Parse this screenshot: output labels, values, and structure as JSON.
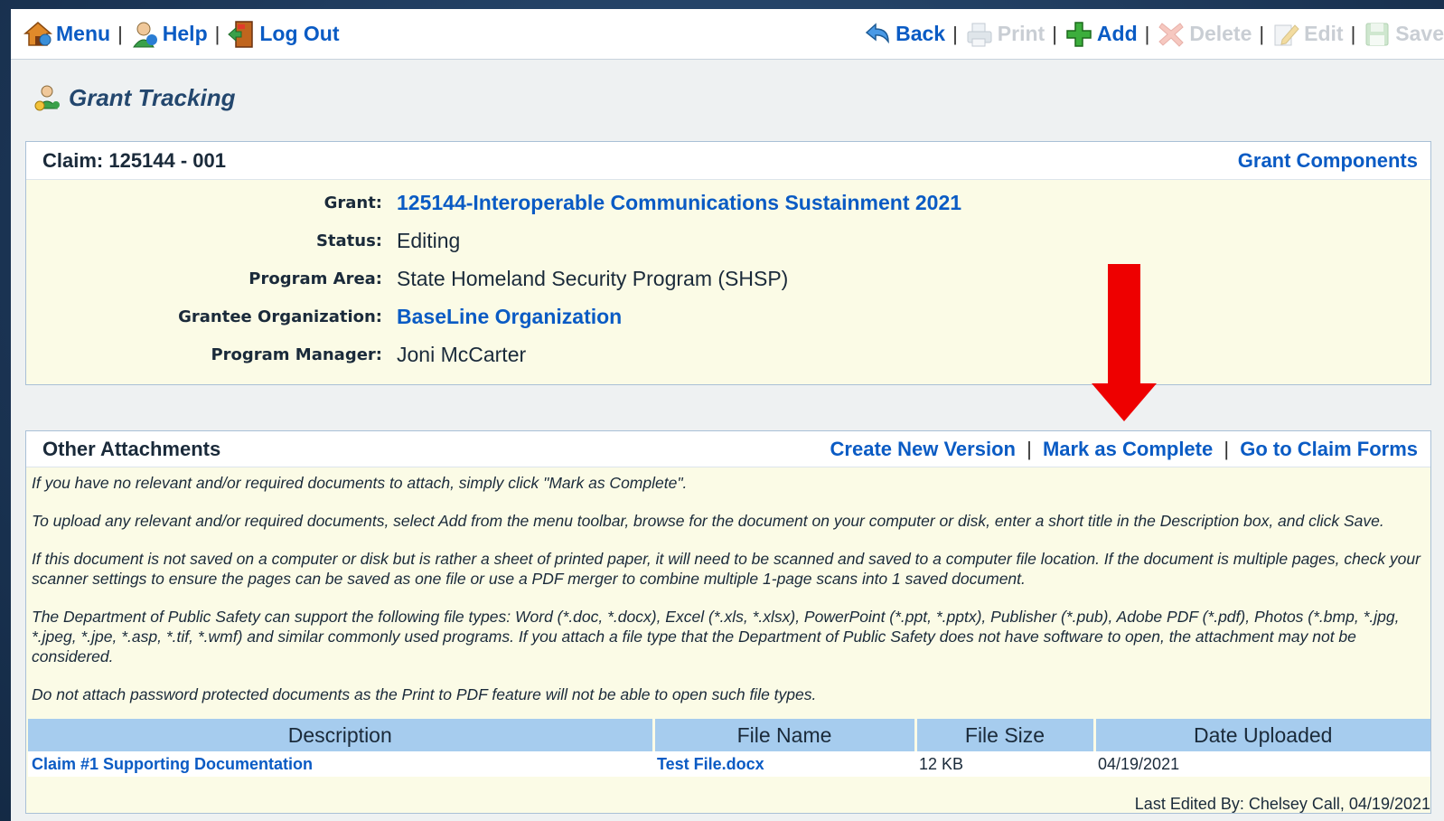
{
  "toolbar": {
    "left": [
      {
        "label": "Menu",
        "icon": "house-icon"
      },
      {
        "label": "Help",
        "icon": "help-person-icon"
      },
      {
        "label": "Log Out",
        "icon": "exit-door-icon"
      }
    ],
    "right": [
      {
        "label": "Back",
        "icon": "back-arrow-icon",
        "enabled": true
      },
      {
        "label": "Print",
        "icon": "printer-icon",
        "enabled": false
      },
      {
        "label": "Add",
        "icon": "add-plus-icon",
        "enabled": true
      },
      {
        "label": "Delete",
        "icon": "delete-x-icon",
        "enabled": false
      },
      {
        "label": "Edit",
        "icon": "edit-pencil-icon",
        "enabled": false
      },
      {
        "label": "Save",
        "icon": "save-disk-icon",
        "enabled": false
      }
    ],
    "separator": "|"
  },
  "page": {
    "title": "Grant Tracking"
  },
  "claim_panel": {
    "title": "Claim: 125144 - 001",
    "action": "Grant Components",
    "fields": {
      "grant_label": "Grant:",
      "grant_value": "125144-Interoperable Communications Sustainment 2021",
      "status_label": "Status:",
      "status_value": "Editing",
      "program_area_label": "Program Area:",
      "program_area_value": "State Homeland Security Program (SHSP)",
      "grantee_label": "Grantee Organization:",
      "grantee_value": "BaseLine Organization",
      "manager_label": "Program Manager:",
      "manager_value": "Joni McCarter"
    }
  },
  "attachments_panel": {
    "title": "Other Attachments",
    "actions": {
      "create_version": "Create New Version",
      "mark_complete": "Mark as Complete",
      "go_to_forms": "Go to Claim Forms",
      "separator": "|"
    },
    "instructions": {
      "p1": "If you have no relevant and/or required documents to attach, simply click \"Mark as Complete\".",
      "p2": "To upload any relevant and/or required documents, select Add from the menu toolbar, browse for the document on your computer or disk, enter a short title in the Description box, and click Save.",
      "p3": "If this document is not saved on a computer or disk but is rather a sheet of printed paper, it will need to be scanned and saved to a computer file location. If the document is multiple pages, check your scanner settings to ensure the pages can be saved as one file or use a PDF merger to combine multiple 1-page scans into 1 saved document.",
      "p4": "The Department of Public Safety can support the following file types: Word (*.doc, *.docx), Excel (*.xls, *.xlsx), PowerPoint (*.ppt, *.pptx), Publisher (*.pub), Adobe PDF (*.pdf), Photos (*.bmp, *.jpg, *.jpeg, *.jpe, *.asp, *.tif, *.wmf) and similar commonly used programs. If you attach a file type that the Department of Public Safety does not have software to open, the attachment may not be considered.",
      "p5": "Do not attach password protected documents as the Print to PDF feature will not be able to open such file types."
    },
    "table": {
      "headers": {
        "description": "Description",
        "file_name": "File Name",
        "file_size": "File Size",
        "date_uploaded": "Date Uploaded"
      },
      "rows": [
        {
          "description": "Claim #1 Supporting Documentation",
          "file_name": "Test File.docx",
          "file_size": "12 KB",
          "date_uploaded": "04/19/2021"
        }
      ]
    },
    "last_edited": "Last Edited By: Chelsey Call, 04/19/2021"
  },
  "colors": {
    "link": "#0a5bc4",
    "panel_bg": "#fbfbe6",
    "table_header": "#a6ccee",
    "annotation_arrow": "#ee0000"
  }
}
